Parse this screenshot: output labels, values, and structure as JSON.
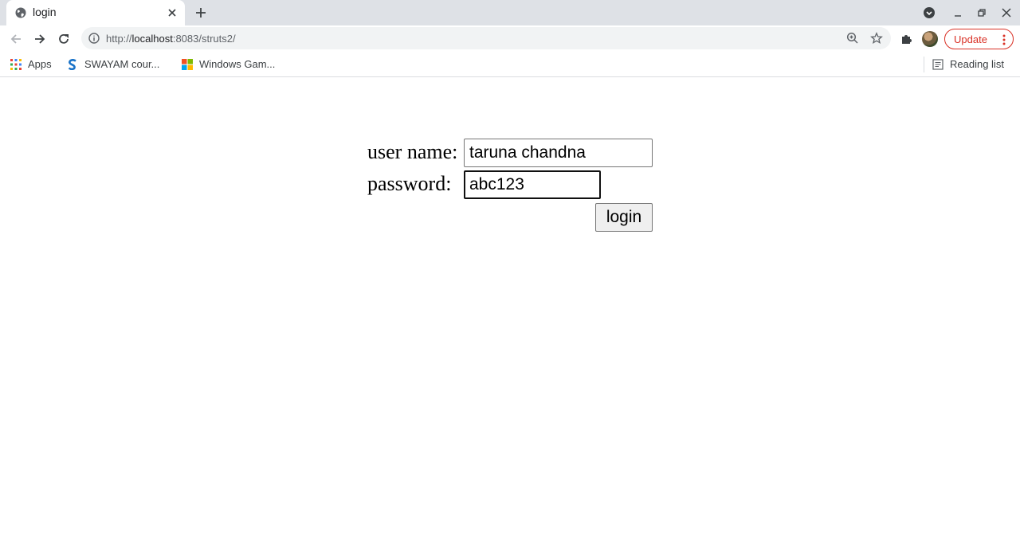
{
  "browser": {
    "tab": {
      "title": "login"
    },
    "url": {
      "scheme": "http://",
      "host": "localhost",
      "rest": ":8083/struts2/"
    },
    "update_label": "Update",
    "bookmarks": [
      {
        "label": "Apps",
        "icon": "apps-grid-icon"
      },
      {
        "label": "SWAYAM cour...",
        "icon": "swayam-icon"
      },
      {
        "label": "Windows Gam...",
        "icon": "windows-logo-icon"
      }
    ],
    "reading_list_label": "Reading list",
    "colors": {
      "update_accent": "#d93025",
      "tabstrip": "#dee1e6",
      "omnibox": "#f1f3f4"
    }
  },
  "login_form": {
    "username_label": "user name:",
    "username_value": "taruna chandna",
    "password_label": "password:",
    "password_value": "abc123",
    "submit_label": "login"
  }
}
